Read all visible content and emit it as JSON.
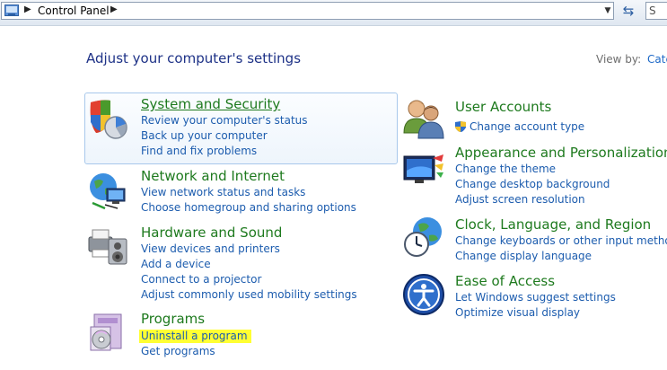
{
  "address_bar": {
    "crumb": "Control Panel",
    "sep": "▶",
    "dropdown": "▼",
    "refresh": "⇆",
    "search_placeholder": "S"
  },
  "header": {
    "title": "Adjust your computer's settings",
    "view_by_label": "View by:",
    "view_by_value": "Cate"
  },
  "categories": [
    {
      "title": "System and Security",
      "icon": "shield-chart-icon",
      "links": [
        "Review your computer's status",
        "Back up your computer",
        "Find and fix problems"
      ]
    },
    {
      "title": "Network and Internet",
      "icon": "globe-network-icon",
      "links": [
        "View network status and tasks",
        "Choose homegroup and sharing options"
      ]
    },
    {
      "title": "Hardware and Sound",
      "icon": "printer-speaker-icon",
      "links": [
        "View devices and printers",
        "Add a device",
        "Connect to a projector",
        "Adjust commonly used mobility settings"
      ]
    },
    {
      "title": "Programs",
      "icon": "programs-disc-icon",
      "links": [
        "Uninstall a program",
        "Get programs"
      ]
    },
    {
      "title": "User Accounts",
      "icon": "users-icon",
      "links": [
        "Change account type"
      ]
    },
    {
      "title": "Appearance and Personalization",
      "icon": "monitor-paint-icon",
      "links": [
        "Change the theme",
        "Change desktop background",
        "Adjust screen resolution"
      ]
    },
    {
      "title": "Clock, Language, and Region",
      "icon": "clock-globe-icon",
      "links": [
        "Change keyboards or other input methods",
        "Change display language"
      ]
    },
    {
      "title": "Ease of Access",
      "icon": "ease-of-access-icon",
      "links": [
        "Let Windows suggest settings",
        "Optimize visual display"
      ]
    }
  ],
  "colors": {
    "category_title": "#1e7a1e",
    "link": "#1c5cae",
    "page_title": "#1e3287",
    "highlight": "#ffff33"
  }
}
